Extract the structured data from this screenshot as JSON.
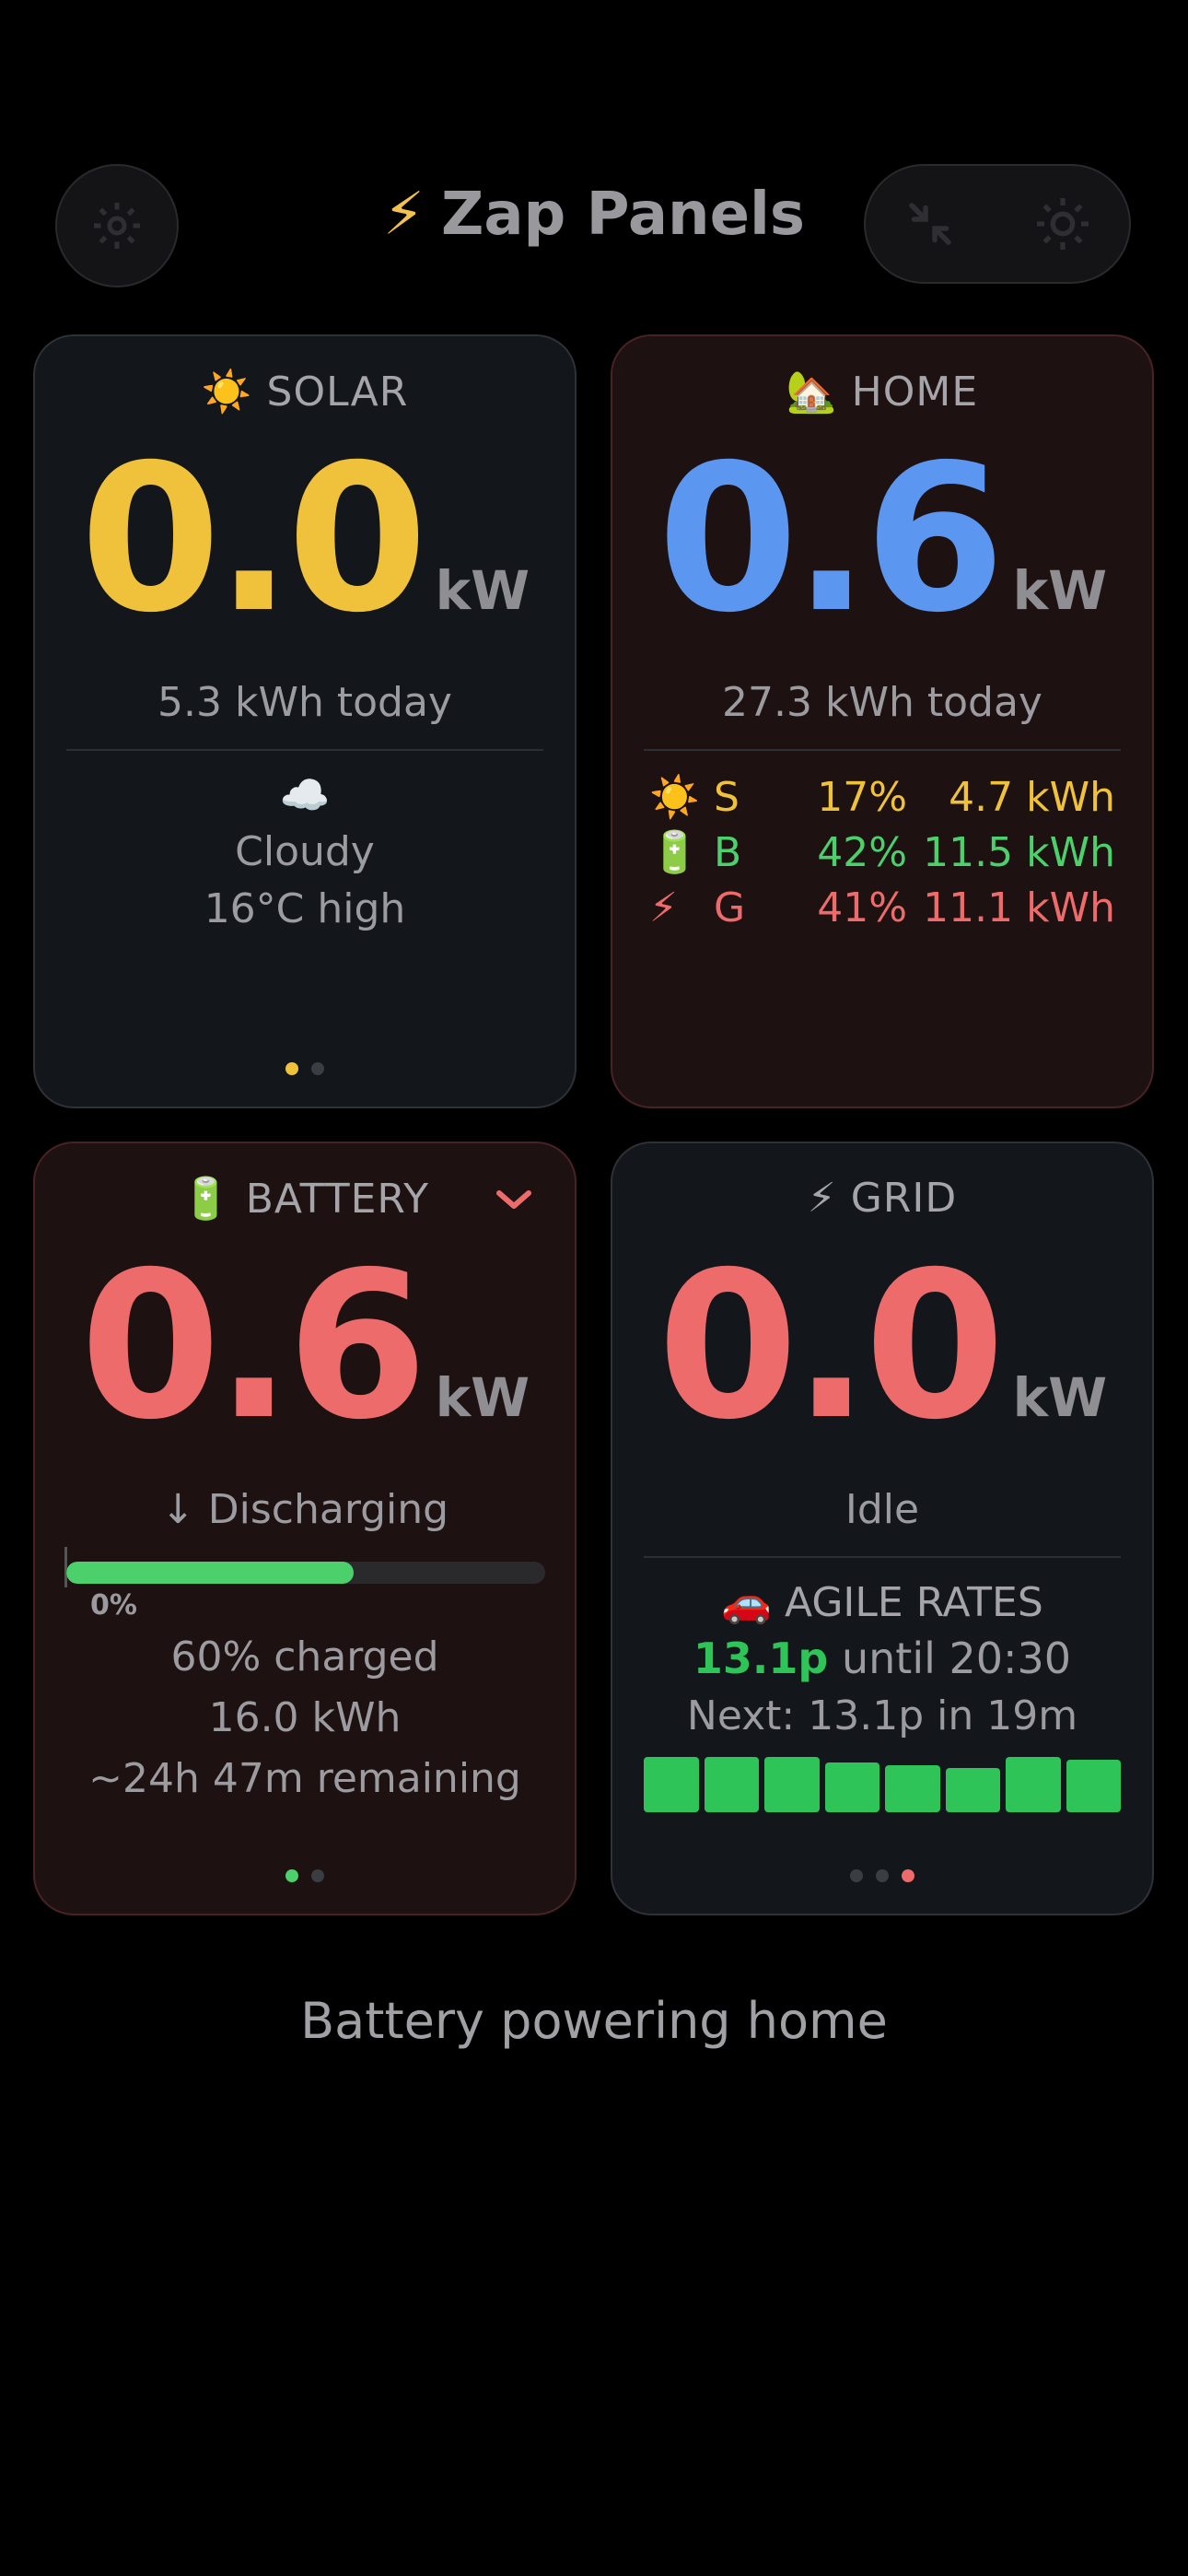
{
  "header": {
    "title": "Zap Panels",
    "title_icon": "⚡",
    "settings_icon": "gear-icon",
    "collapse_icon": "collapse-icon",
    "brightness_icon": "sun-icon"
  },
  "solar": {
    "icon": "☀️",
    "label": "SOLAR",
    "value": "0.0",
    "unit": "kW",
    "today": "5.3 kWh today",
    "weather_icon": "☁️",
    "weather": "Cloudy",
    "high": "16°C high",
    "value_color": "#f0c23b"
  },
  "home": {
    "icon": "🏡",
    "label": "HOME",
    "value": "0.6",
    "unit": "kW",
    "today": "27.3 kWh today",
    "value_color": "#5b96f0",
    "mix": [
      {
        "icon": "☀️",
        "letter": "S",
        "pct": "17%",
        "kwh": "4.7 kWh",
        "color": "#f0c23b"
      },
      {
        "icon": "🔋",
        "letter": "B",
        "pct": "42%",
        "kwh": "11.5 kWh",
        "color": "#4cd06c"
      },
      {
        "icon": "⚡",
        "letter": "G",
        "pct": "41%",
        "kwh": "11.1 kWh",
        "color": "#ee6b6b"
      }
    ]
  },
  "battery": {
    "icon": "🔋",
    "label": "BATTERY",
    "value": "0.6",
    "unit": "kW",
    "state": "↓ Discharging",
    "charge_fraction": 0.6,
    "tick_label": "0%",
    "charged": "60% charged",
    "energy": "16.0 kWh",
    "remaining": "~24h 47m remaining",
    "value_color": "#ee6b6b"
  },
  "grid": {
    "icon": "⚡",
    "label": "GRID",
    "value": "0.0",
    "unit": "kW",
    "state": "Idle",
    "value_color": "#ee6b6b",
    "rates_icon": "🚗",
    "rates_label": "AGILE RATES",
    "current_rate": "13.1p",
    "until": "until 20:30",
    "next": "Next: 13.1p in 19m",
    "rate_levels": [
      1.0,
      1.0,
      1.0,
      0.9,
      0.85,
      0.8,
      1.0,
      0.95
    ]
  },
  "status": "Battery powering home"
}
